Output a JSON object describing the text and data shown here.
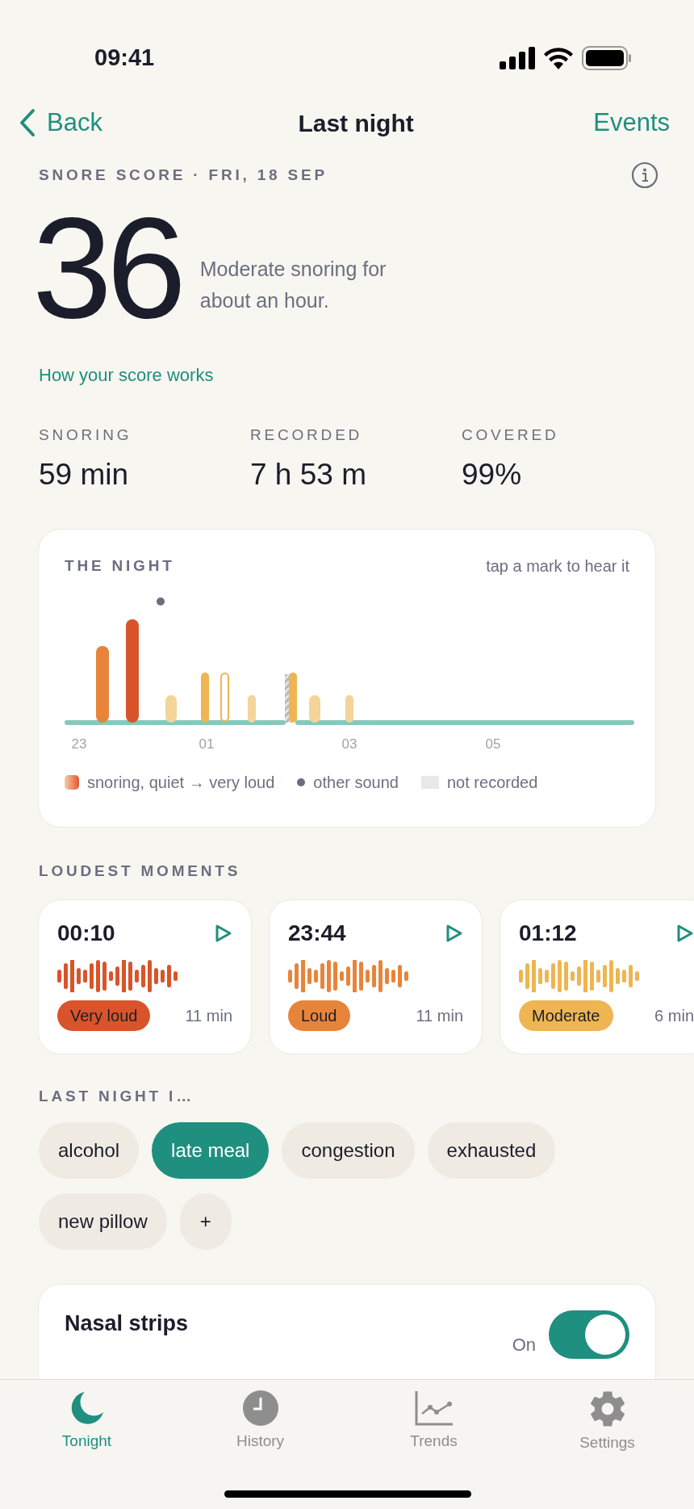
{
  "status_bar": {
    "time": "09:41"
  },
  "nav": {
    "back": "Back",
    "title": "Last night",
    "action": "Events"
  },
  "score": {
    "label": "SNORE SCORE · FRI, 18 SEP",
    "value": "36",
    "summary": "Moderate snoring for about an hour.",
    "link": "How your score works"
  },
  "stats": [
    {
      "label": "SNORING",
      "value": "59 min"
    },
    {
      "label": "RECORDED",
      "value": "7 h 53 m"
    },
    {
      "label": "COVERED",
      "value": "99%"
    }
  ],
  "night": {
    "title": "THE NIGHT",
    "hint": "tap a mark to hear it",
    "x_labels": [
      "23",
      "01",
      "03",
      "05"
    ],
    "legend": [
      {
        "kind": "snoring",
        "label": "snoring, quiet → very loud"
      },
      {
        "kind": "other",
        "label": "other sound"
      },
      {
        "kind": "missing",
        "label": "not recorded"
      }
    ]
  },
  "loudest": {
    "title": "LOUDEST MOMENTS",
    "moments": [
      {
        "time": "00:10",
        "kind": "very_loud",
        "badge": "Very loud",
        "duration": "11 min"
      },
      {
        "time": "23:44",
        "kind": "loud",
        "badge": "Loud",
        "duration": "11 min"
      },
      {
        "time": "01:12",
        "kind": "moderate",
        "badge": "Moderate",
        "duration": "6 min"
      }
    ]
  },
  "factors": {
    "title": "LAST NIGHT I…",
    "chips": [
      {
        "label": "alcohol",
        "selected": false
      },
      {
        "label": "late meal",
        "selected": true
      },
      {
        "label": "congestion",
        "selected": false
      },
      {
        "label": "exhausted",
        "selected": false
      },
      {
        "label": "new pillow",
        "selected": false
      }
    ],
    "add": "+"
  },
  "remedy": {
    "name": "Nasal strips",
    "state_label": "On",
    "on": true
  },
  "tabs": [
    {
      "label": "Tonight",
      "kind": "moon",
      "selected": true
    },
    {
      "label": "History",
      "kind": "clock",
      "selected": false
    },
    {
      "label": "Trends",
      "kind": "chart",
      "selected": false
    },
    {
      "label": "Settings",
      "kind": "gear",
      "selected": false
    }
  ]
}
